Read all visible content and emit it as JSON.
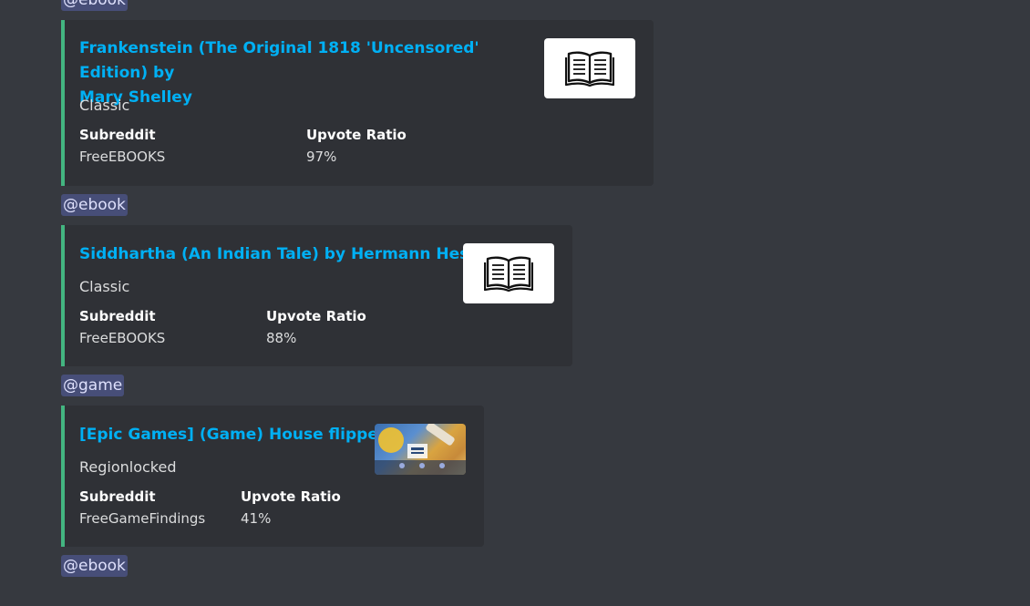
{
  "posts": [
    {
      "mention": "@ebook",
      "title": "Frankenstein (The Original 1818 'Uncensored' Edition) by Mary Shelley",
      "title_line1": "Frankenstein (The Original 1818 'Uncensored' Edition) by",
      "title_line2": "Mary Shelley",
      "category": "Classic",
      "subreddit_label": "Subreddit",
      "subreddit": "FreeEBOOKS",
      "ratio_label": "Upvote Ratio",
      "ratio": "97%",
      "thumbnail": "book-icon"
    },
    {
      "mention": "@ebook",
      "title": "Siddhartha (An Indian Tale) by Hermann Hesse",
      "category": "Classic",
      "subreddit_label": "Subreddit",
      "subreddit": "FreeEBOOKS",
      "ratio_label": "Upvote Ratio",
      "ratio": "88%",
      "thumbnail": "book-icon"
    },
    {
      "mention": "@game",
      "title": "[Epic Games] (Game) House flipper",
      "category": "Regionlocked",
      "subreddit_label": "Subreddit",
      "subreddit": "FreeGameFindings",
      "ratio_label": "Upvote Ratio",
      "ratio": "41%",
      "thumbnail": "game-thumbnail"
    }
  ],
  "trailing_mention": "@ebook",
  "top_mention": "@ebook",
  "colors": {
    "background": "#36393f",
    "embed": "#2f3136",
    "accent": "#43b581",
    "link": "#00b0f4",
    "mention_bg": "#474e78"
  }
}
